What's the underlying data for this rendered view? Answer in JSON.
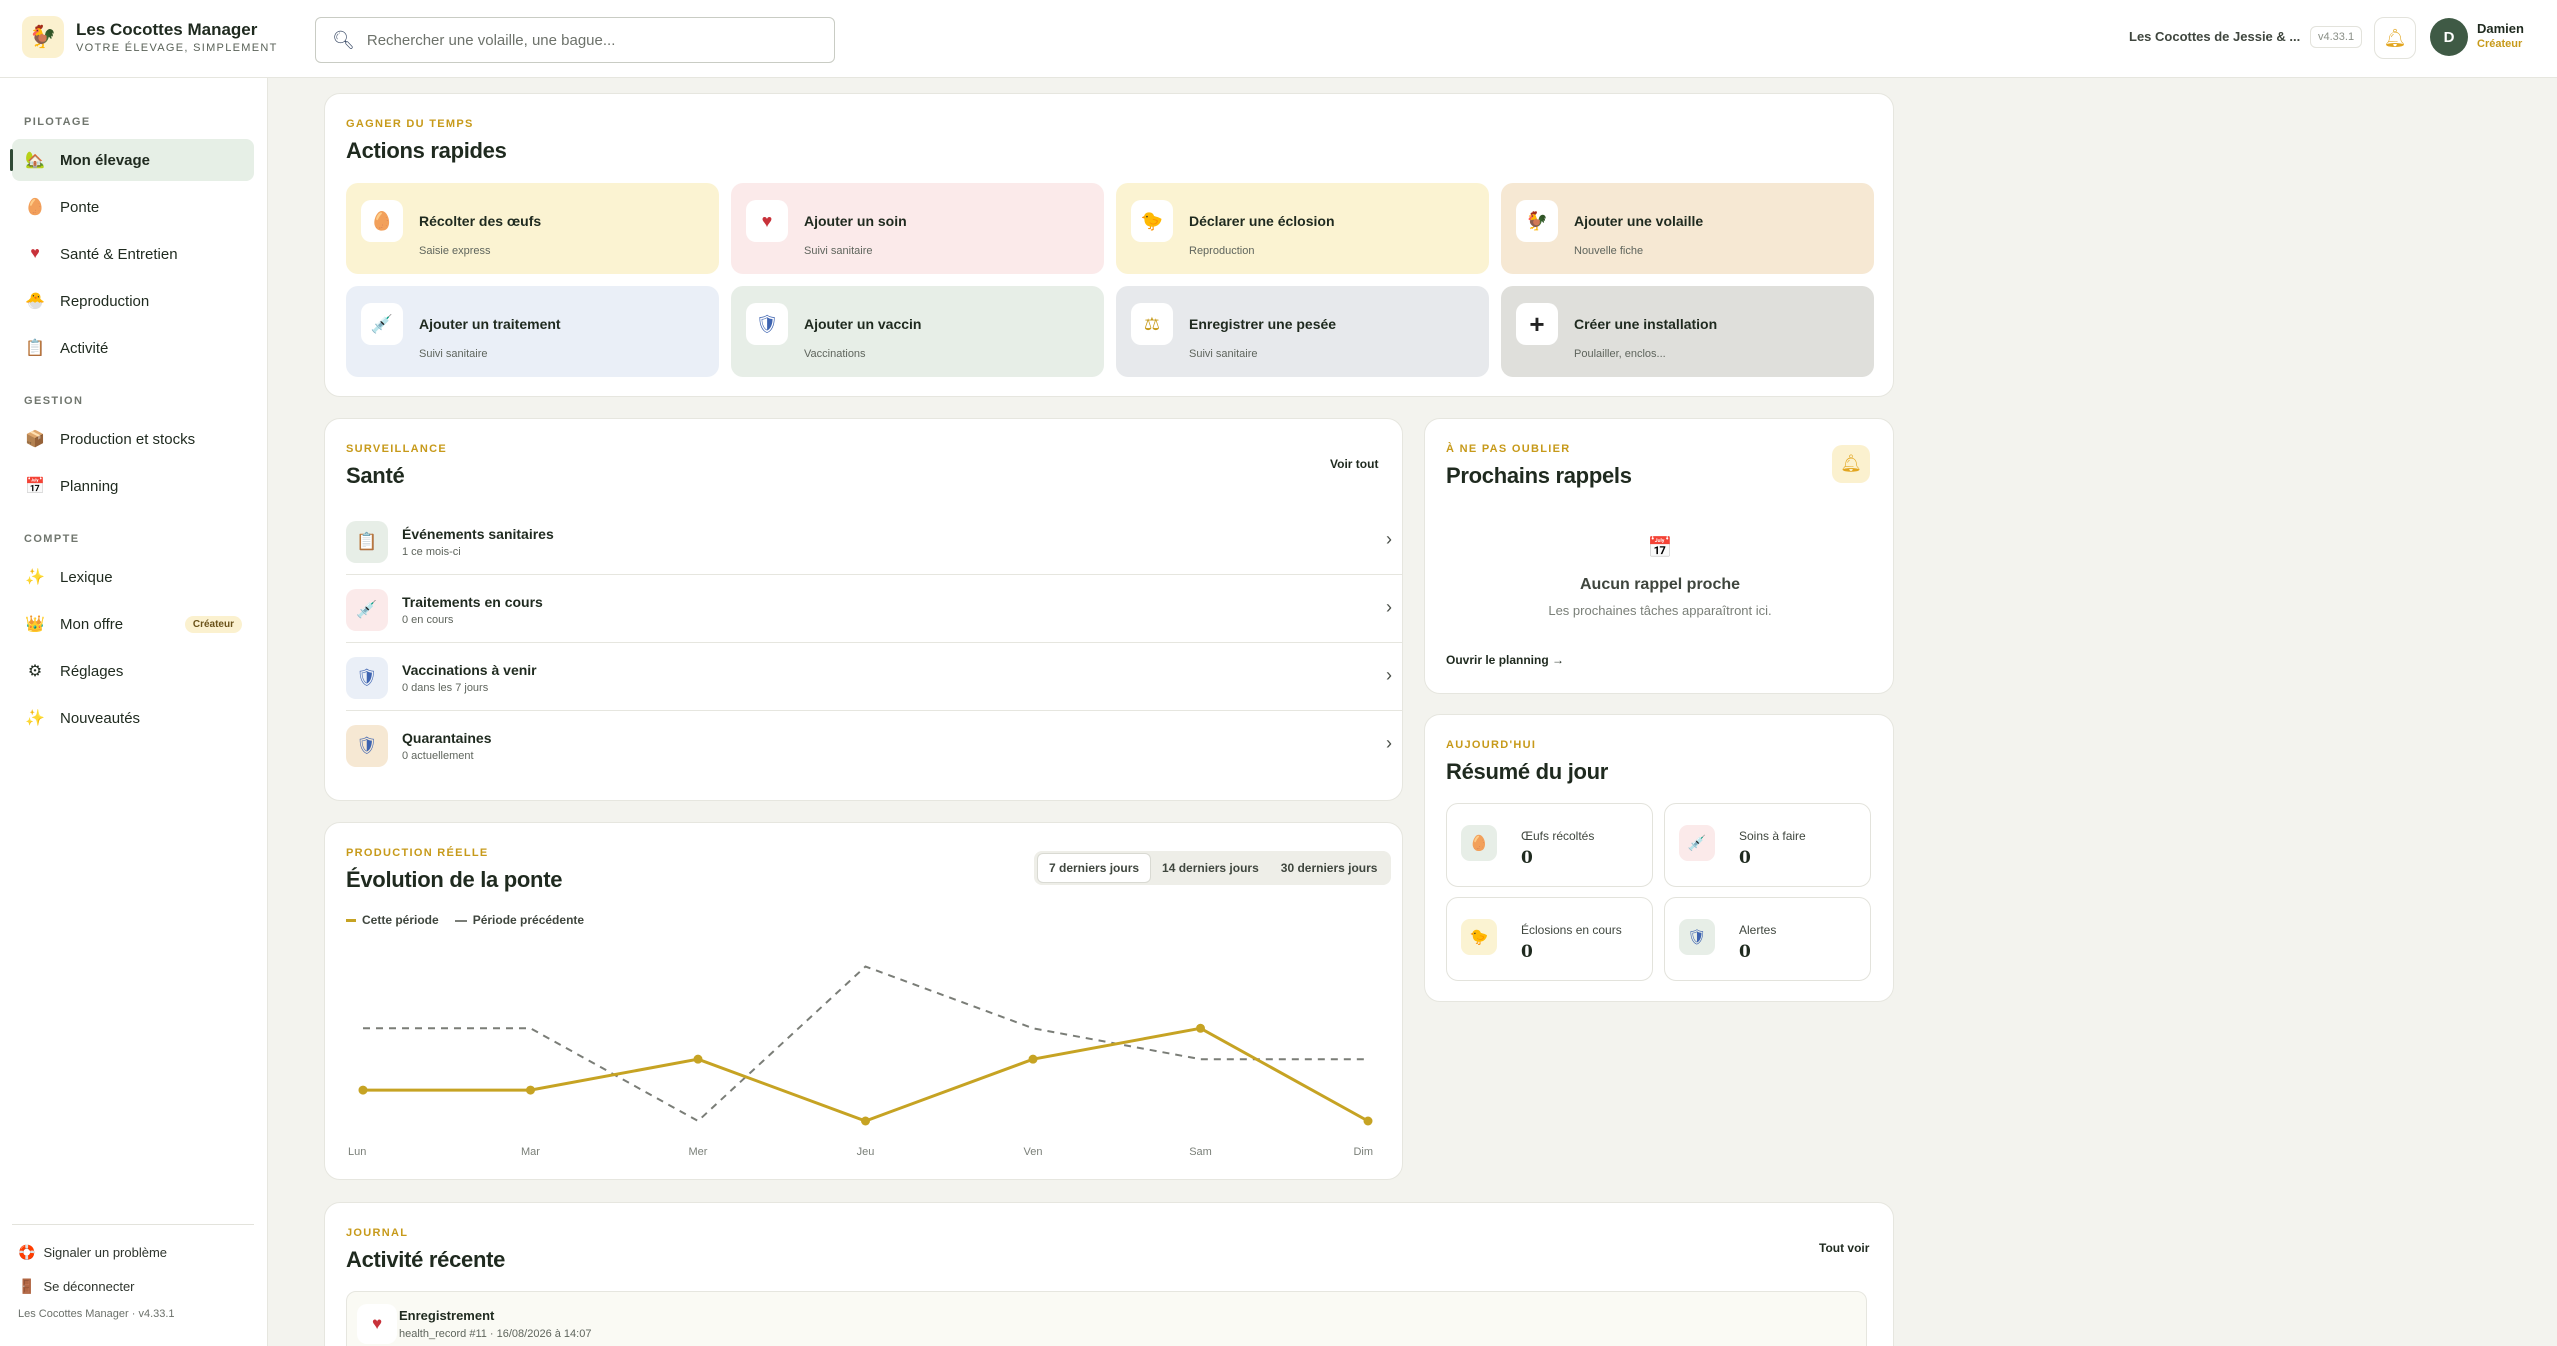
{
  "app": {
    "name": "Les Cocottes Manager",
    "tagline": "VOTRE ÉLEVAGE, SIMPLEMENT",
    "farm_name": "Les Cocottes de Jessie & ...",
    "version": "v4.33.1"
  },
  "search": {
    "placeholder": "Rechercher une volaille, une bague..."
  },
  "user": {
    "initial": "D",
    "name": "Damien",
    "role": "Créateur"
  },
  "sidebar": {
    "sections": [
      {
        "title": "PILOTAGE"
      },
      {
        "title": "GESTION"
      },
      {
        "title": "COMPTE"
      }
    ],
    "items": [
      {
        "label": "Mon élevage",
        "icon": "farm-icon"
      },
      {
        "label": "Ponte",
        "icon": "egg-icon"
      },
      {
        "label": "Santé & Entretien",
        "icon": "heart-icon"
      },
      {
        "label": "Reproduction",
        "icon": "chick-icon"
      },
      {
        "label": "Activité",
        "icon": "clipboard-icon"
      },
      {
        "label": "Production et stocks",
        "icon": "box-icon"
      },
      {
        "label": "Planning",
        "icon": "calendar-icon"
      },
      {
        "label": "Lexique",
        "icon": "sparkle-icon"
      },
      {
        "label": "Mon offre",
        "icon": "crown-icon",
        "badge": "Créateur"
      },
      {
        "label": "Réglages",
        "icon": "gear-icon"
      },
      {
        "label": "Nouveautés",
        "icon": "sparkle-icon"
      }
    ],
    "report_problem": "Signaler un problème",
    "logout": "Se déconnecter",
    "footer": "Les Cocottes Manager · v4.33.1"
  },
  "quick_actions": {
    "eyebrow": "GAGNER DU TEMPS",
    "title": "Actions rapides",
    "items": [
      {
        "label": "Récolter des œufs",
        "sub": "Saisie express",
        "icon": "egg-icon",
        "color": "#fbf3d2"
      },
      {
        "label": "Ajouter un soin",
        "sub": "Suivi sanitaire",
        "icon": "heart-icon",
        "color": "#fbeaea"
      },
      {
        "label": "Déclarer une éclosion",
        "sub": "Reproduction",
        "icon": "chick-icon",
        "color": "#fbf3d2"
      },
      {
        "label": "Ajouter une volaille",
        "sub": "Nouvelle fiche",
        "icon": "chicken-icon",
        "color": "#f6e8d3"
      },
      {
        "label": "Ajouter un traitement",
        "sub": "Suivi sanitaire",
        "icon": "syringe-icon",
        "color": "#eaeff7"
      },
      {
        "label": "Ajouter un vaccin",
        "sub": "Vaccinations",
        "icon": "shield-icon",
        "color": "#e7eee7"
      },
      {
        "label": "Enregistrer une pesée",
        "sub": "Suivi sanitaire",
        "icon": "scale-icon",
        "color": "#e7e9ec"
      },
      {
        "label": "Créer une installation",
        "sub": "Poulailler, enclos...",
        "icon": "plus-icon",
        "color": "#dfdfdb"
      }
    ]
  },
  "health": {
    "eyebrow": "SURVEILLANCE",
    "title": "Santé",
    "see_all": "Voir tout",
    "rows": [
      {
        "title": "Événements sanitaires",
        "sub": "1 ce mois-ci",
        "icon": "clipboard-icon",
        "color": "#e7eee7"
      },
      {
        "title": "Traitements en cours",
        "sub": "0 en cours",
        "icon": "syringe-icon",
        "color": "#fbeaea"
      },
      {
        "title": "Vaccinations à venir",
        "sub": "0 dans les 7 jours",
        "icon": "shield-icon",
        "color": "#eaeff7"
      },
      {
        "title": "Quarantaines",
        "sub": "0 actuellement",
        "icon": "shield-icon",
        "color": "#f6e8d3"
      }
    ]
  },
  "reminders": {
    "eyebrow": "À NE PAS OUBLIER",
    "title": "Prochains rappels",
    "empty_title": "Aucun rappel proche",
    "empty_sub": "Les prochaines tâches apparaîtront ici.",
    "open_link": "Ouvrir le planning →"
  },
  "laying": {
    "eyebrow": "PRODUCTION RÉELLE",
    "title": "Évolution de la ponte",
    "tabs": [
      "7 derniers jours",
      "14 derniers jours",
      "30 derniers jours"
    ],
    "active_tab": 0,
    "legend_current": "Cette période",
    "legend_previous": "Période précédente"
  },
  "chart_data": {
    "type": "line",
    "x": [
      "Lun",
      "Mar",
      "Mer",
      "Jeu",
      "Ven",
      "Sam",
      "Dim"
    ],
    "series": [
      {
        "name": "Cette période",
        "values": [
          1,
          1,
          2,
          0,
          2,
          3,
          0
        ],
        "color": "#c6a323",
        "style": "solid"
      },
      {
        "name": "Période précédente",
        "values": [
          3,
          3,
          0,
          5,
          3,
          2,
          2
        ],
        "color": "#7a7d77",
        "style": "dashed"
      }
    ],
    "ylim": [
      0,
      5.5
    ],
    "grid": false,
    "legend": "top-left"
  },
  "summary": {
    "eyebrow": "AUJOURD'HUI",
    "title": "Résumé du jour",
    "stats": [
      {
        "label": "Œufs récoltés",
        "value": "0",
        "icon": "egg-icon",
        "color": "#e7eee7"
      },
      {
        "label": "Soins à faire",
        "value": "0",
        "icon": "syringe-icon",
        "color": "#fbeaea"
      },
      {
        "label": "Éclosions en cours",
        "value": "0",
        "icon": "chick-icon",
        "color": "#fbf3d2"
      },
      {
        "label": "Alertes",
        "value": "0",
        "icon": "shield-icon",
        "color": "#e7eee7"
      }
    ]
  },
  "activity": {
    "eyebrow": "JOURNAL",
    "title": "Activité récente",
    "see_all": "Tout voir",
    "items": [
      {
        "title": "Enregistrement",
        "sub": "health_record #11 · 16/08/2026 à 14:07",
        "icon": "heart-icon"
      }
    ]
  },
  "colors": {
    "accent": "#c79a1a",
    "brand_green": "#2f4a35",
    "background": "#f3f3ee"
  }
}
